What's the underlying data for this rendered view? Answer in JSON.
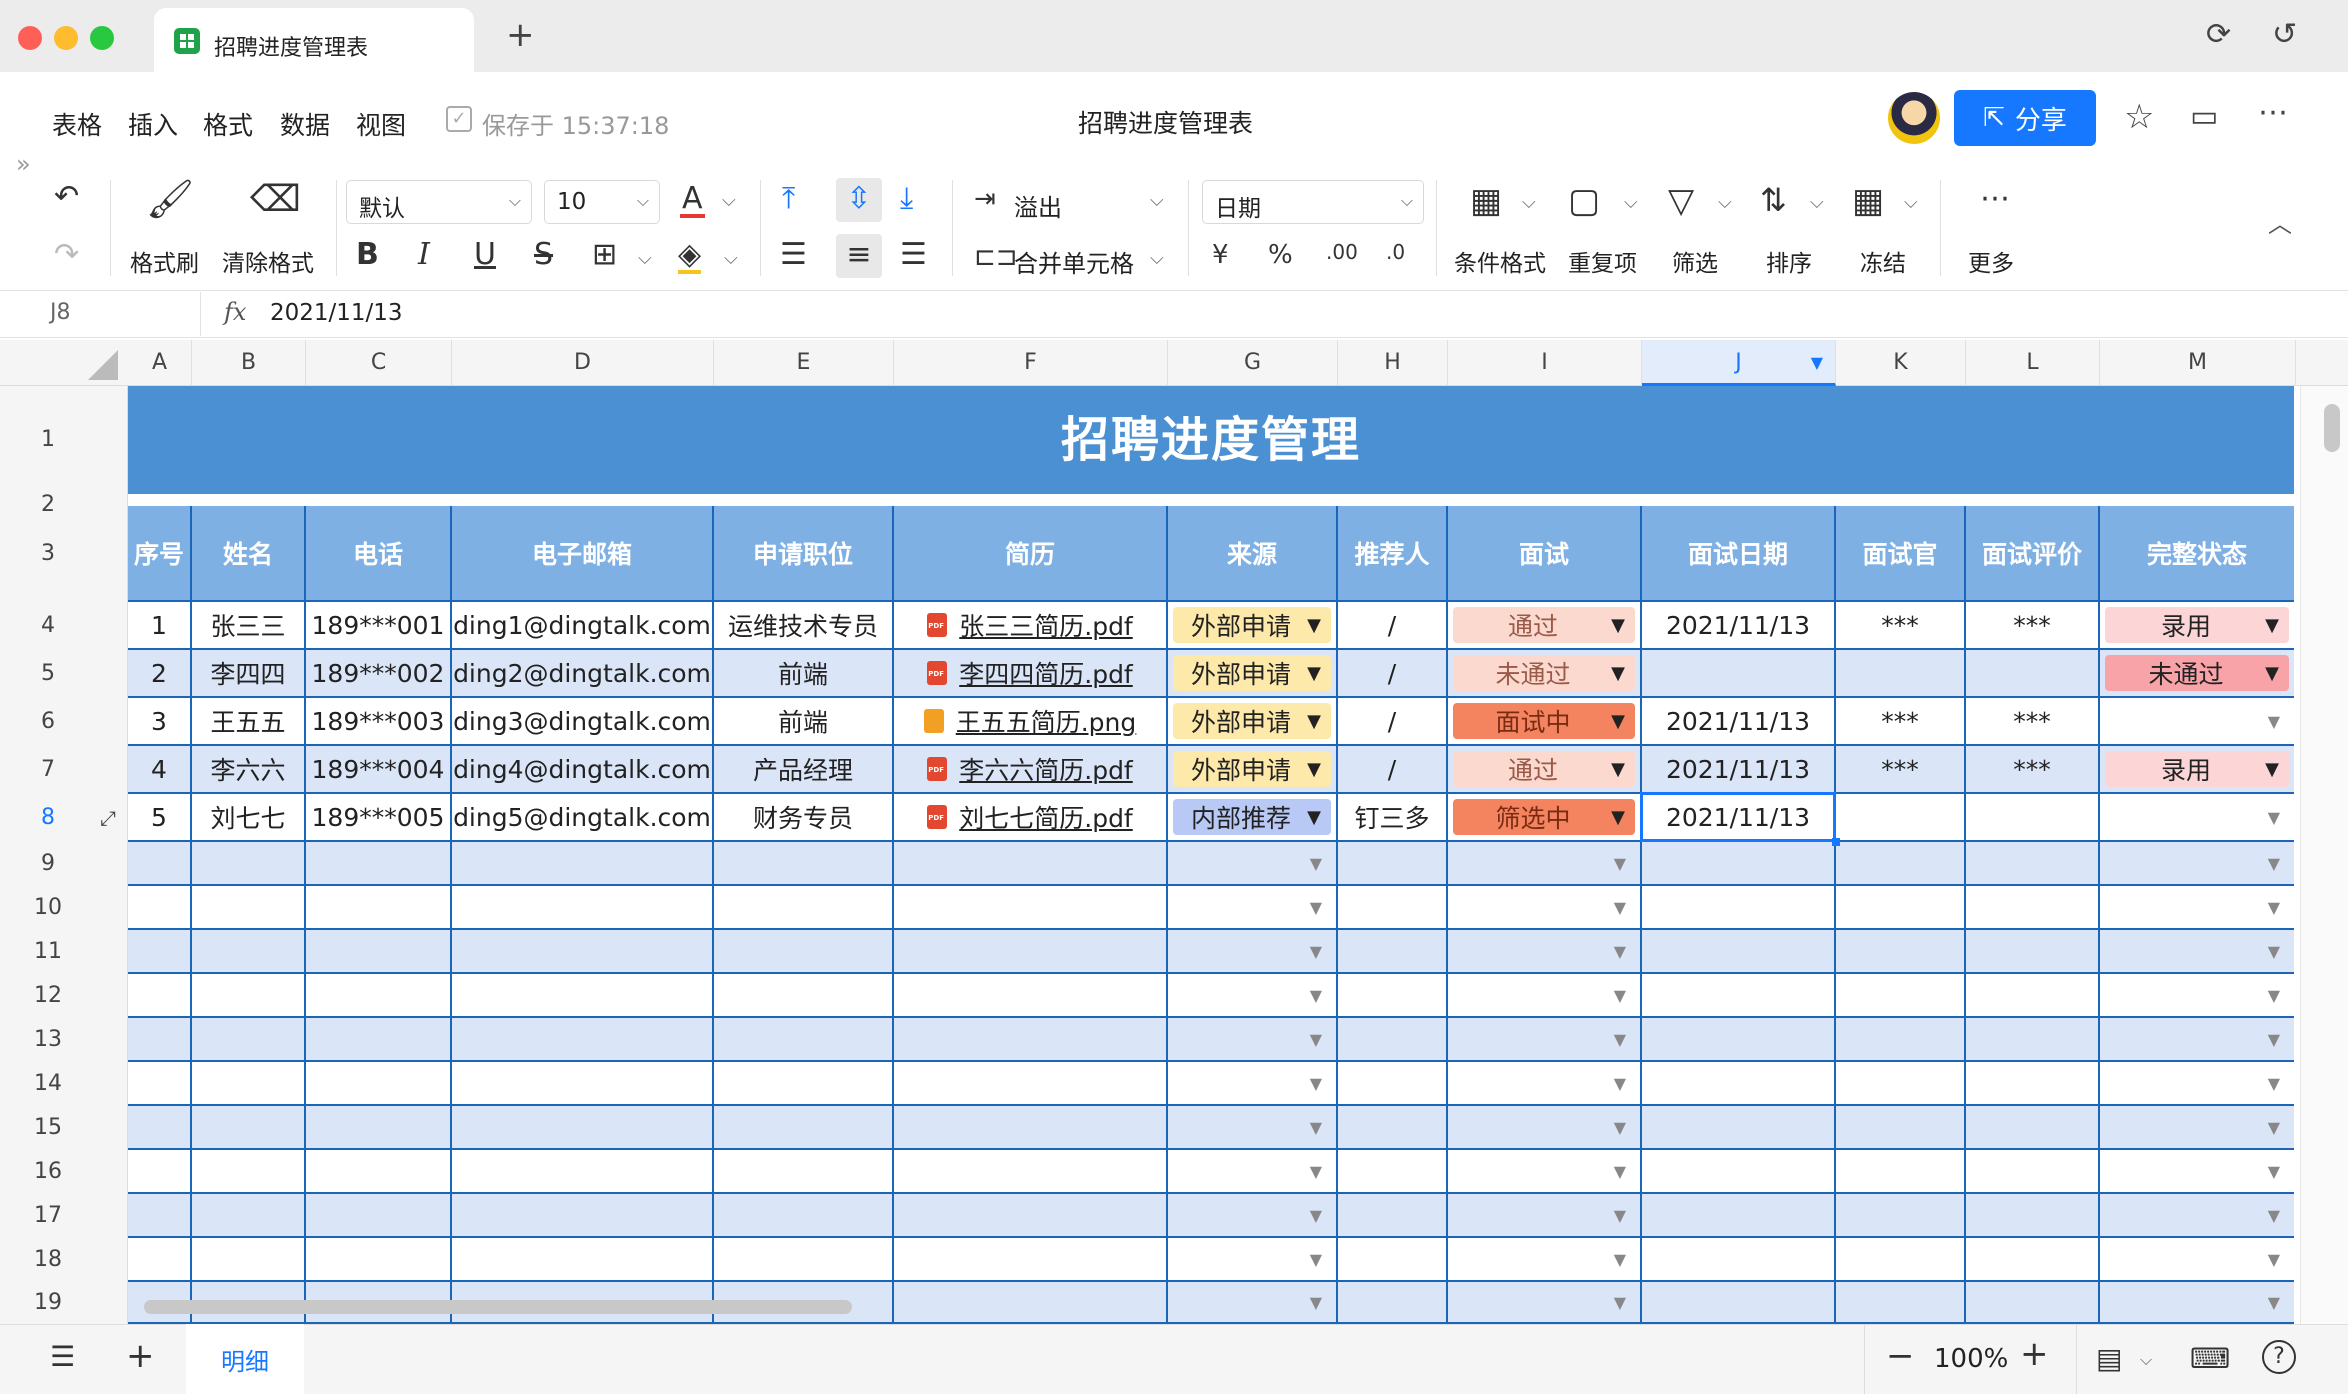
{
  "window": {
    "tab_title": "招聘进度管理表",
    "new_tab": "+"
  },
  "menu": {
    "items": [
      "表格",
      "插入",
      "格式",
      "数据",
      "视图"
    ],
    "saved": "保存于 15:37:18",
    "doc_title": "招聘进度管理表",
    "share": "分享"
  },
  "toolbar": {
    "format_painter": "格式刷",
    "clear_format": "清除格式",
    "font": "默认",
    "size": "10",
    "overflow": "溢出",
    "merge": "合并单元格",
    "number_format": "日期",
    "cond_format": "条件格式",
    "dup": "重复项",
    "filter": "筛选",
    "sort": "排序",
    "freeze": "冻结",
    "more": "更多"
  },
  "formula": {
    "cell": "J8",
    "fx": "fx",
    "value": "2021/11/13"
  },
  "columns": [
    "A",
    "B",
    "C",
    "D",
    "E",
    "F",
    "G",
    "H",
    "I",
    "J",
    "K",
    "L",
    "M"
  ],
  "rows": [
    "1",
    "2",
    "3",
    "4",
    "5",
    "6",
    "7",
    "8",
    "9",
    "10",
    "11",
    "12",
    "13",
    "14",
    "15",
    "16",
    "17",
    "18",
    "19"
  ],
  "sheet": {
    "title": "招聘进度管理",
    "headers": [
      "序号",
      "姓名",
      "电话",
      "电子邮箱",
      "申请职位",
      "简历",
      "来源",
      "推荐人",
      "面试",
      "面试日期",
      "面试官",
      "面试评价",
      "完整状态"
    ],
    "records": [
      {
        "no": "1",
        "name": "张三三",
        "phone": "189***001",
        "email": "ding1@dingtalk.com",
        "pos": "运维技术专员",
        "resume": "张三三简历.pdf",
        "rtype": "pdf",
        "source": "外部申请",
        "ref": "/",
        "interview": "通过",
        "date": "2021/11/13",
        "interviewer": "***",
        "eval": "***",
        "status": "录用"
      },
      {
        "no": "2",
        "name": "李四四",
        "phone": "189***002",
        "email": "ding2@dingtalk.com",
        "pos": "前端",
        "resume": "李四四简历.pdf",
        "rtype": "pdf",
        "source": "外部申请",
        "ref": "/",
        "interview": "未通过",
        "date": "",
        "interviewer": "",
        "eval": "",
        "status": "未通过"
      },
      {
        "no": "3",
        "name": "王五五",
        "phone": "189***003",
        "email": "ding3@dingtalk.com",
        "pos": "前端",
        "resume": "王五五简历.png",
        "rtype": "png",
        "source": "外部申请",
        "ref": "/",
        "interview": "面试中",
        "date": "2021/11/13",
        "interviewer": "***",
        "eval": "***",
        "status": ""
      },
      {
        "no": "4",
        "name": "李六六",
        "phone": "189***004",
        "email": "ding4@dingtalk.com",
        "pos": "产品经理",
        "resume": "李六六简历.pdf",
        "rtype": "pdf",
        "source": "外部申请",
        "ref": "/",
        "interview": "通过",
        "date": "2021/11/13",
        "interviewer": "***",
        "eval": "***",
        "status": "录用"
      },
      {
        "no": "5",
        "name": "刘七七",
        "phone": "189***005",
        "email": "ding5@dingtalk.com",
        "pos": "财务专员",
        "resume": "刘七七简历.pdf",
        "rtype": "pdf",
        "source": "内部推荐",
        "ref": "钉三多",
        "interview": "筛选中",
        "date": "2021/11/13",
        "interviewer": "",
        "eval": "",
        "status": ""
      }
    ]
  },
  "pill_colors": {
    "外部申请": "#fde9a9",
    "内部推荐": "#b9c9f5",
    "通过": "#fcd9cf",
    "未通过": "#fcd9cf",
    "面试中": "#f3845f",
    "筛选中": "#f3845f",
    "录用": "#fcd6d6",
    "status_未通过": "#f8a3a8"
  },
  "bottom": {
    "sheet_tab": "明细",
    "zoom": "100%"
  },
  "colors": {
    "accent": "#1677ff",
    "banner": "#4a90d2",
    "header": "#7fb0e4",
    "band": "#dbe5f8",
    "border": "#1b66b8"
  }
}
